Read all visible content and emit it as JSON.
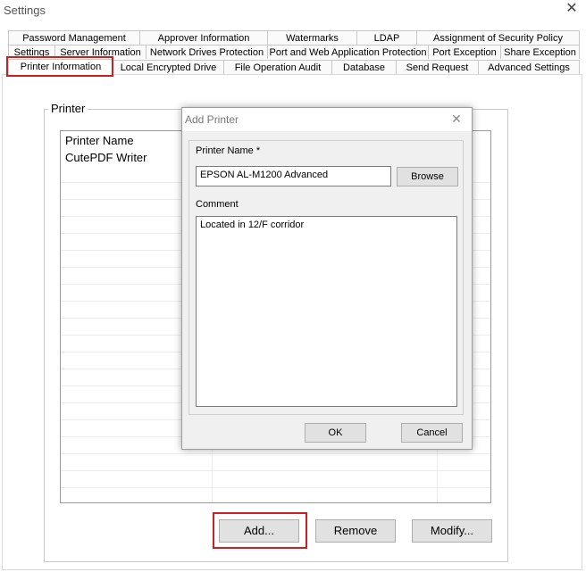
{
  "window": {
    "title": "Settings",
    "close_glyph": "✕"
  },
  "tabs": {
    "row1": [
      "Password Management",
      "Approver Information",
      "Watermarks",
      "LDAP",
      "Assignment of Security Policy"
    ],
    "row2": [
      "Settings",
      "Server Information",
      "Network Drives Protection",
      "Port and Web Application Protection",
      "Port Exception",
      "Share Exception"
    ],
    "row3": [
      "Printer Information",
      "Local Encrypted Drive",
      "File Operation Audit",
      "Database",
      "Send Request",
      "Advanced Settings"
    ],
    "active": "Printer Information"
  },
  "printer_group": {
    "label": "Printer",
    "column_header": "Printer Name",
    "items": [
      "CutePDF Writer"
    ]
  },
  "buttons": {
    "add": "Add...",
    "remove": "Remove",
    "modify": "Modify..."
  },
  "dialog": {
    "title": "Add Printer",
    "close_glyph": "✕",
    "printer_name_label": "Printer Name *",
    "printer_name_value": "EPSON AL-M1200 Advanced",
    "browse": "Browse",
    "comment_label": "Comment",
    "comment_value": "Located in 12/F corridor",
    "ok": "OK",
    "cancel": "Cancel"
  },
  "colors": {
    "highlight": "#cc1f1f"
  }
}
